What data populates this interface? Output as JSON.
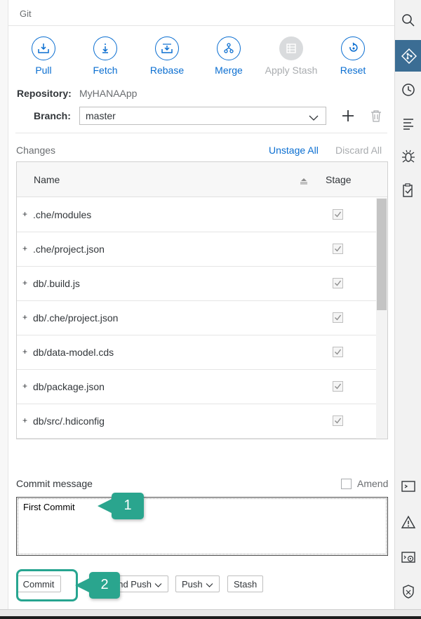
{
  "panel": {
    "title": "Git"
  },
  "toolbar": {
    "pull": "Pull",
    "fetch": "Fetch",
    "rebase": "Rebase",
    "merge": "Merge",
    "apply_stash": "Apply Stash",
    "reset": "Reset"
  },
  "repository": {
    "label": "Repository:",
    "value": "MyHANAApp"
  },
  "branch": {
    "label": "Branch:",
    "value": "master"
  },
  "changes": {
    "label": "Changes",
    "unstage_all": "Unstage All",
    "discard_all": "Discard All",
    "columns": {
      "name": "Name",
      "stage": "Stage"
    },
    "rows": [
      {
        "prefix": "+",
        "name": ".che/modules",
        "staged": true
      },
      {
        "prefix": "+",
        "name": ".che/project.json",
        "staged": true
      },
      {
        "prefix": "+",
        "name": "db/.build.js",
        "staged": true
      },
      {
        "prefix": "+",
        "name": "db/.che/project.json",
        "staged": true
      },
      {
        "prefix": "+",
        "name": "db/data-model.cds",
        "staged": true
      },
      {
        "prefix": "+",
        "name": "db/package.json",
        "staged": true
      },
      {
        "prefix": "+",
        "name": "db/src/.hdiconfig",
        "staged": true
      }
    ]
  },
  "commit": {
    "label": "Commit message",
    "amend_label": "Amend",
    "message": "First Commit",
    "commit_button": "Commit",
    "commit_push_button": "and Push",
    "push_button": "Push",
    "stash_button": "Stash"
  },
  "callouts": {
    "first": "1",
    "second": "2"
  },
  "colors": {
    "accent": "#0a6ed1",
    "callout": "#2aa58e",
    "active_tab": "#3b6d94"
  },
  "right_sidebar": [
    "search-icon",
    "git-icon",
    "history-icon",
    "outline-icon",
    "debugger-icon",
    "clipboard-check-icon",
    "terminal-icon",
    "warning-icon",
    "run-console-icon",
    "security-shield-icon"
  ]
}
